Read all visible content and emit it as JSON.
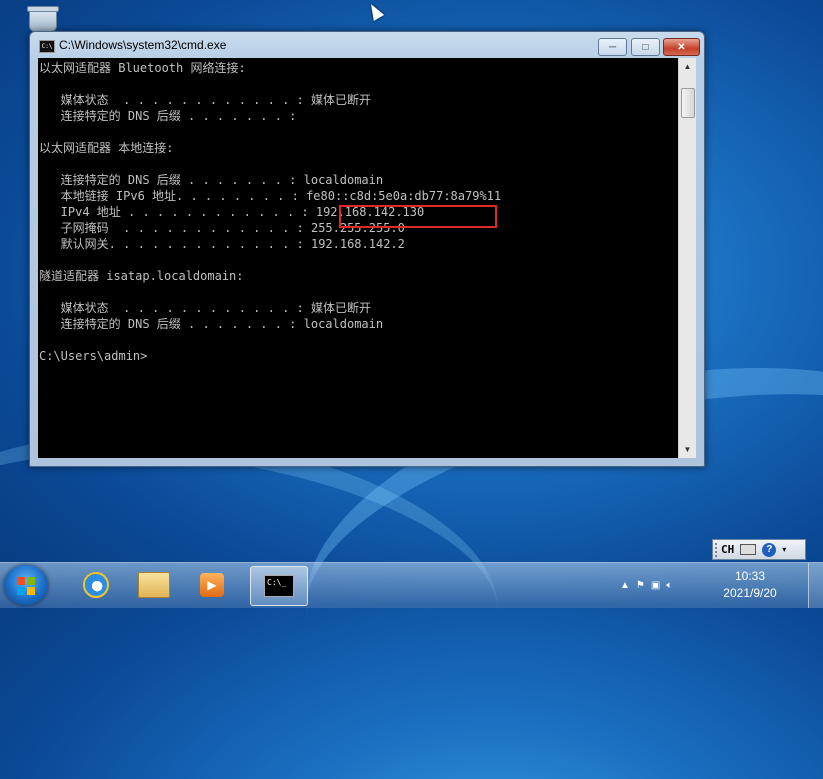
{
  "window": {
    "title": "C:\\Windows\\system32\\cmd.exe",
    "icon_label": "C:\\"
  },
  "console": {
    "lines": [
      "以太网适配器 Bluetooth 网络连接:",
      "",
      "   媒体状态  . . . . . . . . . . . . : 媒体已断开",
      "   连接特定的 DNS 后缀 . . . . . . . :",
      "",
      "以太网适配器 本地连接:",
      "",
      "   连接特定的 DNS 后缀 . . . . . . . : localdomain",
      "   本地链接 IPv6 地址. . . . . . . . : fe80::c8d:5e0a:db77:8a79%11",
      "   IPv4 地址 . . . . . . . . . . . . : 192.168.142.130",
      "   子网掩码  . . . . . . . . . . . . : 255.255.255.0",
      "   默认网关. . . . . . . . . . . . . : 192.168.142.2",
      "",
      "隧道适配器 isatap.localdomain:",
      "",
      "   媒体状态  . . . . . . . . . . . . : 媒体已断开",
      "   连接特定的 DNS 后缀 . . . . . . . : localdomain",
      "",
      "C:\\Users\\admin>"
    ],
    "highlighted_value": "192.168.142.130"
  },
  "langbar": {
    "language": "CH"
  },
  "clock": {
    "time": "10:33",
    "date": "2021/9/20"
  },
  "taskbar": {
    "cmd_button_label": "C:\\_"
  },
  "colors": {
    "console_bg": "#000000",
    "console_text": "#c0c0c0",
    "highlight_border": "#e0282a"
  }
}
